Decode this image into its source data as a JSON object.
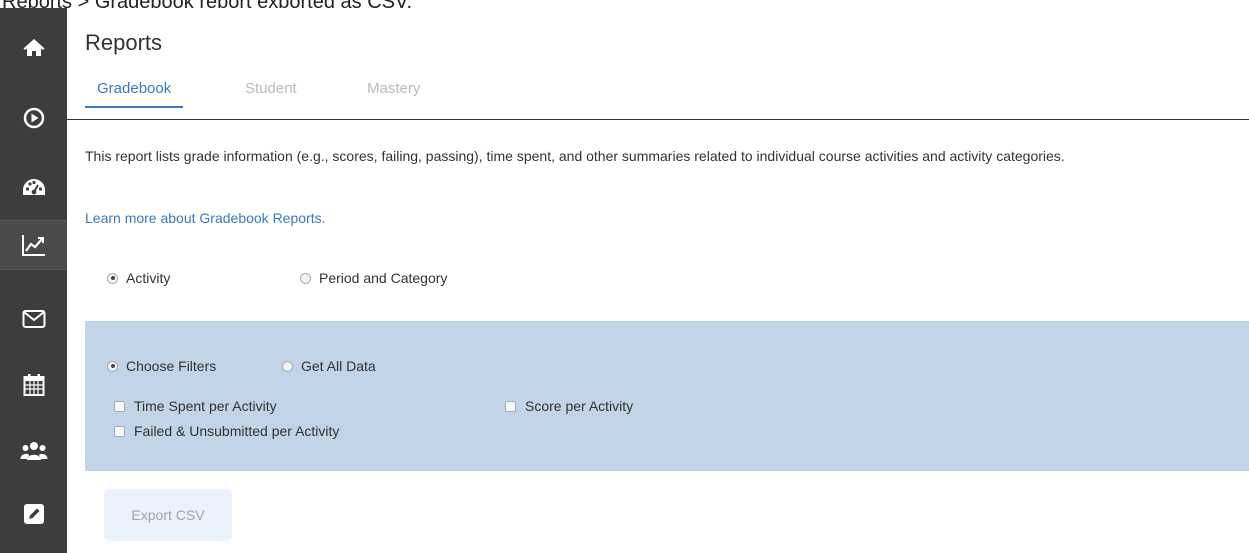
{
  "caption": "Reports > Gradebook report exported as CSV.",
  "sidebar": {
    "items": [
      {
        "icon": "home-icon"
      },
      {
        "icon": "play-circle-icon"
      },
      {
        "icon": "dashboard-gauge-icon"
      },
      {
        "icon": "line-chart-icon",
        "active": true
      },
      {
        "icon": "envelope-icon"
      },
      {
        "icon": "calendar-icon"
      },
      {
        "icon": "users-group-icon"
      },
      {
        "icon": "edit-pencil-icon"
      }
    ]
  },
  "header": {
    "title": "Reports",
    "tabs": [
      {
        "label": "Gradebook",
        "active": true
      },
      {
        "label": "Student",
        "active": false
      },
      {
        "label": "Mastery",
        "active": false
      }
    ]
  },
  "content": {
    "description": "This report lists grade information (e.g., scores, failing, passing), time spent, and other summaries related to individual course activities and activity categories.",
    "learn_more": "Learn more about Gradebook Reports.",
    "report_type": {
      "options": [
        "Activity",
        "Period and Category"
      ],
      "selected": "Activity"
    },
    "filters": {
      "mode_options": [
        "Choose Filters",
        "Get All Data"
      ],
      "mode_selected": "Choose Filters",
      "checkboxes": [
        {
          "label": "Time Spent per Activity",
          "checked": false
        },
        {
          "label": "Score per Activity",
          "checked": false
        },
        {
          "label": "Failed & Unsubmitted per Activity",
          "checked": false
        }
      ]
    },
    "export_label": "Export CSV"
  },
  "colors": {
    "sidebar_bg": "#3d3d3d",
    "accent": "#3a7cb8",
    "filter_panel_bg": "#c2d4e8",
    "export_button_bg": "#eaf3fc"
  }
}
